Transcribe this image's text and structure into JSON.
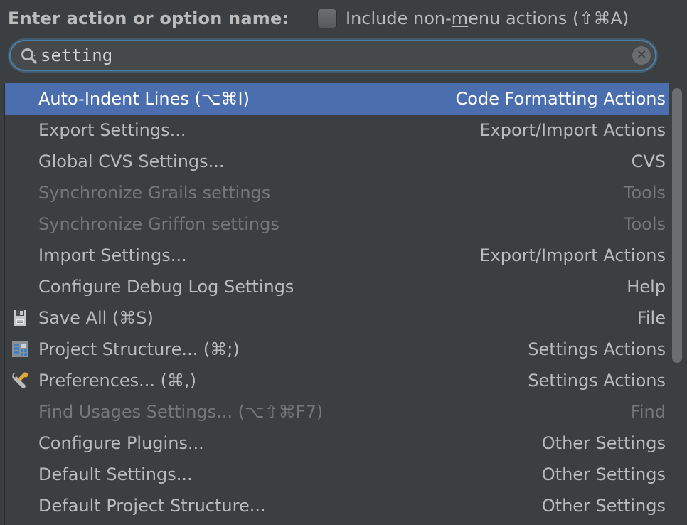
{
  "header": {
    "prompt": "Enter action or option name:",
    "nonmenu_pre": "Include non-",
    "nonmenu_u": "m",
    "nonmenu_post": "enu actions (⇧⌘A)",
    "nonmenu_checked": false
  },
  "search": {
    "value": "setting",
    "icon": "search-icon",
    "clear_icon": "clear-icon",
    "clear_glyph": "✕"
  },
  "colors": {
    "selected_row": "#4b6eaf",
    "disabled_text": "#74787a",
    "normal_text": "#bbbbbb",
    "focus_ring": "#4d7ea5"
  },
  "results": [
    {
      "name": "Auto-Indent Lines (⌥⌘I)",
      "group": "Code Formatting Actions",
      "selected": true
    },
    {
      "name": "Export Settings...",
      "group": "Export/Import Actions"
    },
    {
      "name": "Global CVS Settings...",
      "group": "CVS"
    },
    {
      "name": "Synchronize Grails settings",
      "group": "Tools",
      "disabled": true
    },
    {
      "name": "Synchronize Griffon settings",
      "group": "Tools",
      "disabled": true
    },
    {
      "name": "Import Settings...",
      "group": "Export/Import Actions"
    },
    {
      "name": "Configure Debug Log Settings",
      "group": "Help"
    },
    {
      "name": "Save All (⌘S)",
      "group": "File",
      "icon": "save-icon"
    },
    {
      "name": "Project Structure... (⌘;)",
      "group": "Settings Actions",
      "icon": "project-structure-icon"
    },
    {
      "name": "Preferences... (⌘,)",
      "group": "Settings Actions",
      "icon": "wrench-icon"
    },
    {
      "name": "Find Usages Settings... (⌥⇧⌘F7)",
      "group": "Find",
      "disabled": true
    },
    {
      "name": "Configure Plugins...",
      "group": "Other Settings"
    },
    {
      "name": "Default Settings...",
      "group": "Other Settings"
    },
    {
      "name": "Default Project Structure...",
      "group": "Other Settings"
    }
  ]
}
